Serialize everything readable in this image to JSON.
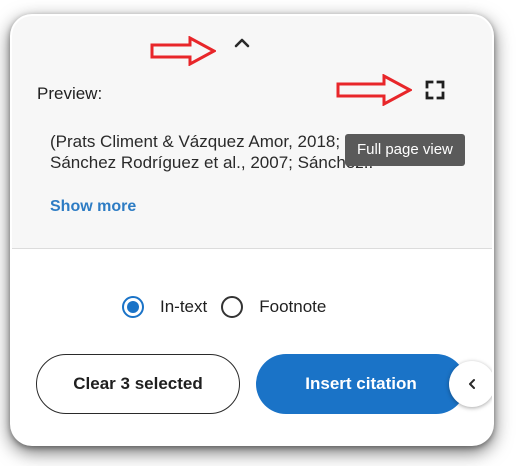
{
  "preview": {
    "label": "Preview:",
    "lines": [
      "(Prats Climent & Vázquez Amor, 2018; Sánchez",
      "Sánchez Rodríguez et al., 2007; Sánchez.."
    ],
    "show_more": "Show more"
  },
  "tooltip": {
    "text": "Full page view"
  },
  "icons": {
    "collapse": "chevron-up-icon",
    "fullpage": "fullscreen-icon",
    "side": "chevron-left-icon",
    "annotation": "red-arrow-icon"
  },
  "citation_style": {
    "options": [
      {
        "label": "In-text",
        "selected": true
      },
      {
        "label": "Footnote",
        "selected": false
      }
    ]
  },
  "actions": {
    "clear_label": "Clear 3 selected",
    "insert_label": "Insert citation"
  },
  "colors": {
    "accent": "#1a73c7",
    "link": "#2d7cc4",
    "annotation_arrow": "#e8262a",
    "tooltip_bg": "#5a5a5a"
  }
}
